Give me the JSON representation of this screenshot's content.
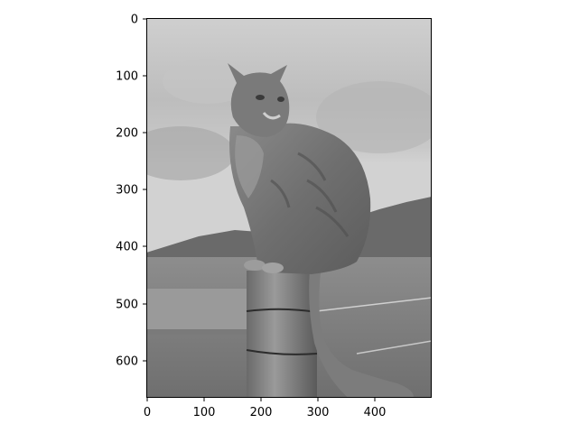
{
  "figure": {
    "background": "#ffffff",
    "image_description_icon": "grayscale-photo-icon",
    "x_ticks": [
      "0",
      "100",
      "200",
      "300",
      "400"
    ],
    "y_ticks": [
      "0",
      "100",
      "200",
      "300",
      "400",
      "500",
      "600"
    ]
  }
}
